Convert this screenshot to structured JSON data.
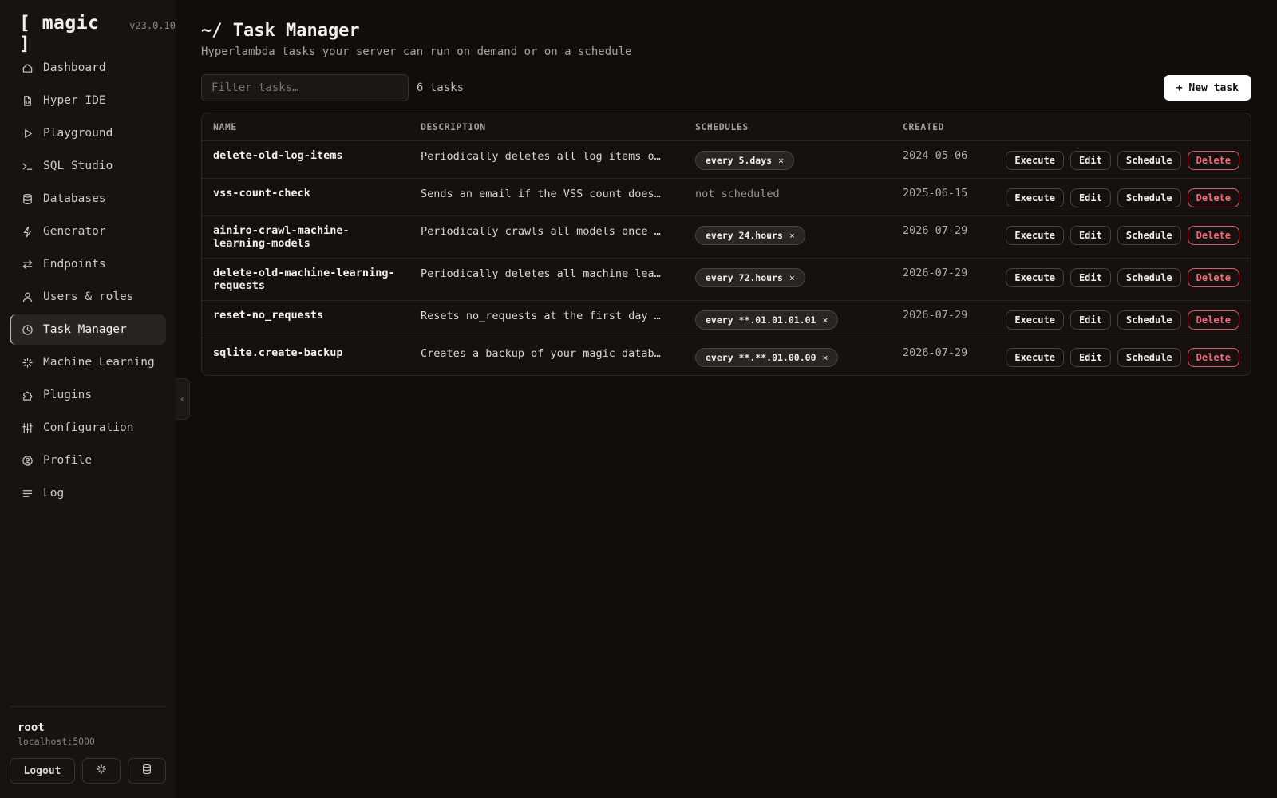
{
  "brand": {
    "name": "[ magic ]",
    "version": "v23.0.10"
  },
  "nav": [
    {
      "label": "Dashboard",
      "icon": "home-icon"
    },
    {
      "label": "Hyper IDE",
      "icon": "file-code-icon"
    },
    {
      "label": "Playground",
      "icon": "play-icon"
    },
    {
      "label": "SQL Studio",
      "icon": "terminal-icon"
    },
    {
      "label": "Databases",
      "icon": "database-icon"
    },
    {
      "label": "Generator",
      "icon": "bolt-icon"
    },
    {
      "label": "Endpoints",
      "icon": "arrows-exchange-icon"
    },
    {
      "label": "Users & roles",
      "icon": "user-icon"
    },
    {
      "label": "Task Manager",
      "icon": "clock-icon",
      "active": true
    },
    {
      "label": "Machine Learning",
      "icon": "sparkle-icon"
    },
    {
      "label": "Plugins",
      "icon": "puzzle-icon"
    },
    {
      "label": "Configuration",
      "icon": "sliders-icon"
    },
    {
      "label": "Profile",
      "icon": "user-circle-icon"
    },
    {
      "label": "Log",
      "icon": "lines-icon"
    }
  ],
  "user": {
    "name": "root",
    "host": "localhost:5000"
  },
  "footer": {
    "logout_label": "Logout"
  },
  "page": {
    "title": "~/ Task Manager",
    "subtitle": "Hyperlambda tasks your server can run on demand or on a schedule"
  },
  "toolbar": {
    "filter_placeholder": "Filter tasks…",
    "task_count": "6 tasks",
    "new_task_label": "+ New task"
  },
  "table": {
    "columns": [
      "NAME",
      "DESCRIPTION",
      "SCHEDULES",
      "CREATED"
    ],
    "actions": {
      "execute": "Execute",
      "edit": "Edit",
      "schedule": "Schedule",
      "delete": "Delete"
    },
    "not_scheduled_label": "not scheduled",
    "rows": [
      {
        "name": "delete-old-log-items",
        "description": "Periodically deletes all log items o…",
        "schedules": [
          "every 5.days"
        ],
        "created": "2024-05-06"
      },
      {
        "name": "vss-count-check",
        "description": "Sends an email if the VSS count does…",
        "schedules": [],
        "created": "2025-06-15"
      },
      {
        "name": "ainiro-crawl-machine-learning-models",
        "description": "Periodically crawls all models once …",
        "schedules": [
          "every 24.hours"
        ],
        "created": "2026-07-29"
      },
      {
        "name": "delete-old-machine-learning-requests",
        "description": "Periodically deletes all machine lea…",
        "schedules": [
          "every 72.hours"
        ],
        "created": "2026-07-29"
      },
      {
        "name": "reset-no_requests",
        "description": "Resets no_requests at the first day …",
        "schedules": [
          "every **.01.01.01.01"
        ],
        "created": "2026-07-29"
      },
      {
        "name": "sqlite.create-backup",
        "description": "Creates a backup of your magic datab…",
        "schedules": [
          "every **.**.01.00.00"
        ],
        "created": "2026-07-29"
      }
    ]
  },
  "colors": {
    "background": "#110d0b",
    "sidebar": "#181311",
    "danger": "#ef6b7b",
    "primary_button": "#ffffff"
  }
}
